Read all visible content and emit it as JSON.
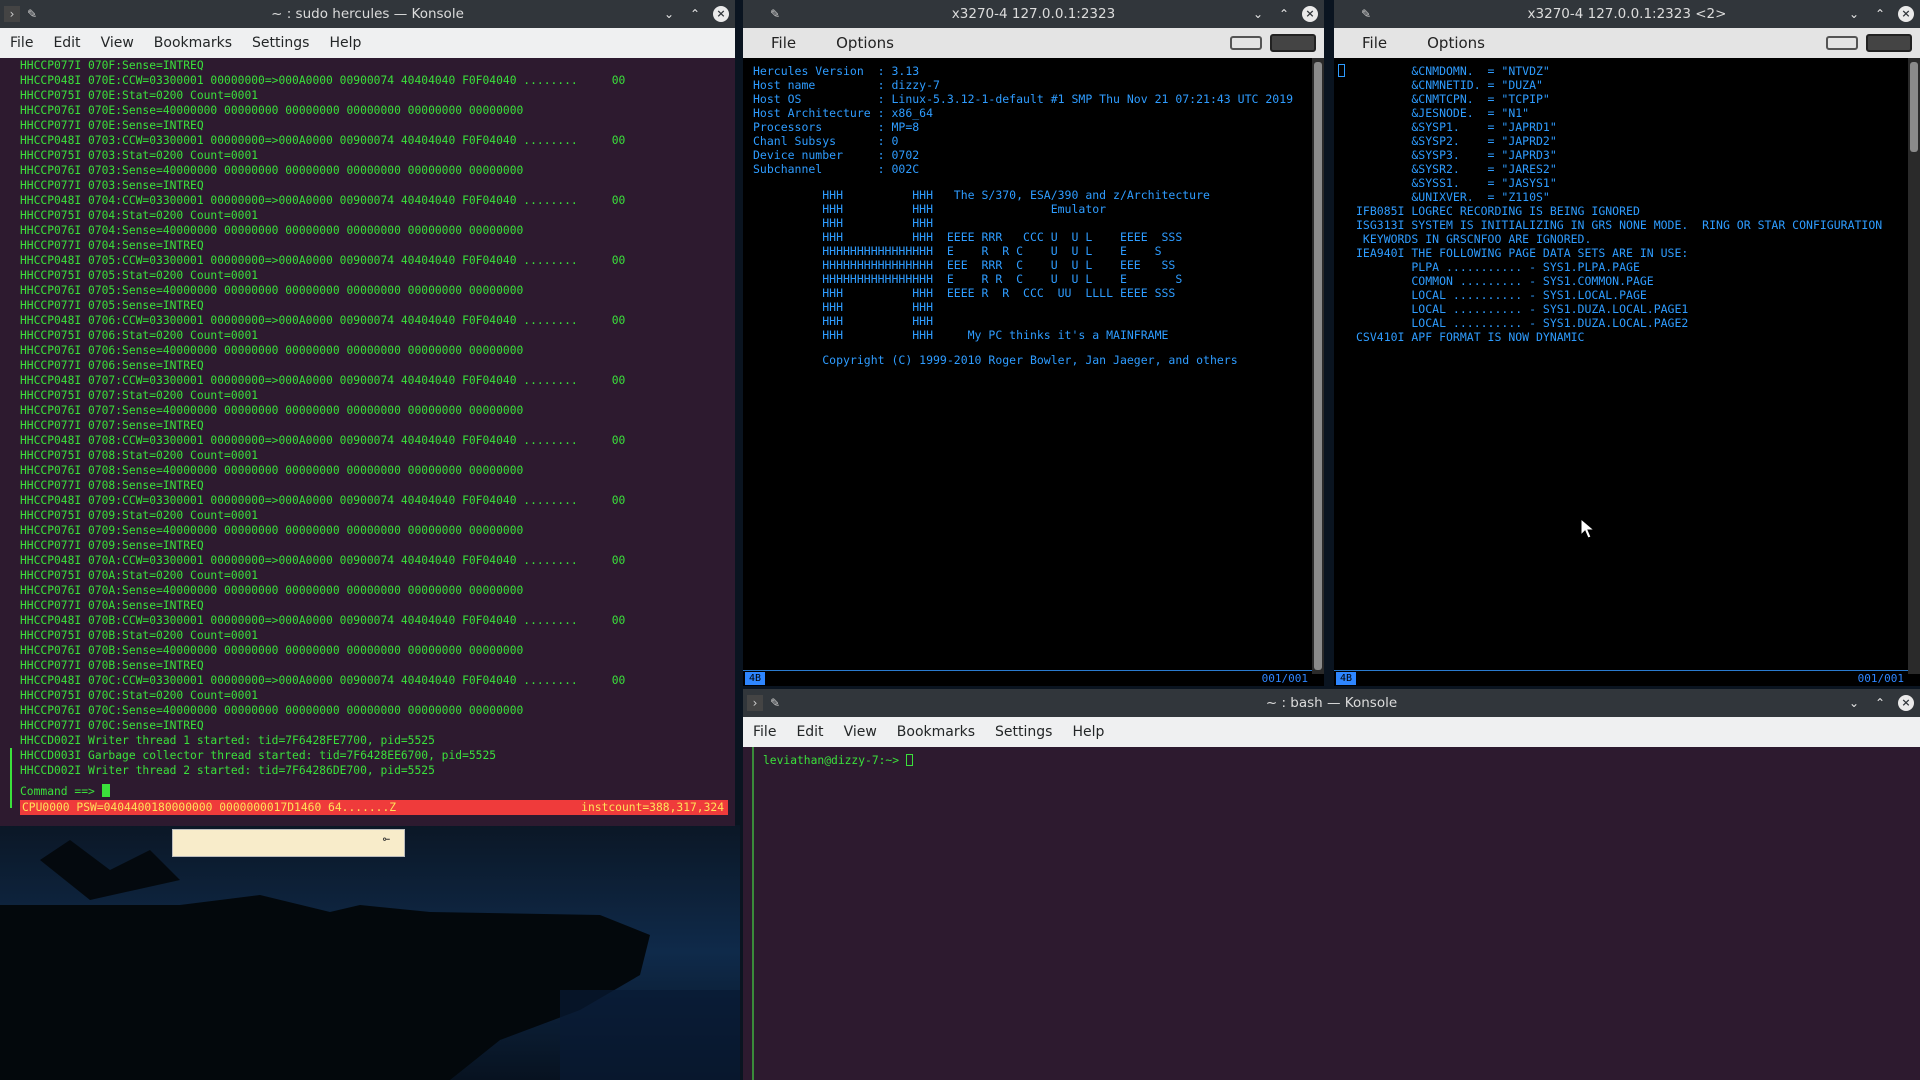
{
  "konsole_hercules": {
    "title": "~ : sudo hercules — Konsole",
    "menu": [
      "File",
      "Edit",
      "View",
      "Bookmarks",
      "Settings",
      "Help"
    ],
    "log_lines": [
      "HHCCP077I 070F:Sense=INTREQ",
      "HHCCP048I 070E:CCW=03300001 00000000=>000A0000 00900074 40404040 F0F04040 ........     00",
      "HHCCP075I 070E:Stat=0200 Count=0001",
      "HHCCP076I 070E:Sense=40000000 00000000 00000000 00000000 00000000 00000000",
      "HHCCP077I 070E:Sense=INTREQ",
      "HHCCP048I 0703:CCW=03300001 00000000=>000A0000 00900074 40404040 F0F04040 ........     00",
      "HHCCP075I 0703:Stat=0200 Count=0001",
      "HHCCP076I 0703:Sense=40000000 00000000 00000000 00000000 00000000 00000000",
      "HHCCP077I 0703:Sense=INTREQ",
      "HHCCP048I 0704:CCW=03300001 00000000=>000A0000 00900074 40404040 F0F04040 ........     00",
      "HHCCP075I 0704:Stat=0200 Count=0001",
      "HHCCP076I 0704:Sense=40000000 00000000 00000000 00000000 00000000 00000000",
      "HHCCP077I 0704:Sense=INTREQ",
      "HHCCP048I 0705:CCW=03300001 00000000=>000A0000 00900074 40404040 F0F04040 ........     00",
      "HHCCP075I 0705:Stat=0200 Count=0001",
      "HHCCP076I 0705:Sense=40000000 00000000 00000000 00000000 00000000 00000000",
      "HHCCP077I 0705:Sense=INTREQ",
      "HHCCP048I 0706:CCW=03300001 00000000=>000A0000 00900074 40404040 F0F04040 ........     00",
      "HHCCP075I 0706:Stat=0200 Count=0001",
      "HHCCP076I 0706:Sense=40000000 00000000 00000000 00000000 00000000 00000000",
      "HHCCP077I 0706:Sense=INTREQ",
      "HHCCP048I 0707:CCW=03300001 00000000=>000A0000 00900074 40404040 F0F04040 ........     00",
      "HHCCP075I 0707:Stat=0200 Count=0001",
      "HHCCP076I 0707:Sense=40000000 00000000 00000000 00000000 00000000 00000000",
      "HHCCP077I 0707:Sense=INTREQ",
      "HHCCP048I 0708:CCW=03300001 00000000=>000A0000 00900074 40404040 F0F04040 ........     00",
      "HHCCP075I 0708:Stat=0200 Count=0001",
      "HHCCP076I 0708:Sense=40000000 00000000 00000000 00000000 00000000 00000000",
      "HHCCP077I 0708:Sense=INTREQ",
      "HHCCP048I 0709:CCW=03300001 00000000=>000A0000 00900074 40404040 F0F04040 ........     00",
      "HHCCP075I 0709:Stat=0200 Count=0001",
      "HHCCP076I 0709:Sense=40000000 00000000 00000000 00000000 00000000 00000000",
      "HHCCP077I 0709:Sense=INTREQ",
      "HHCCP048I 070A:CCW=03300001 00000000=>000A0000 00900074 40404040 F0F04040 ........     00",
      "HHCCP075I 070A:Stat=0200 Count=0001",
      "HHCCP076I 070A:Sense=40000000 00000000 00000000 00000000 00000000 00000000",
      "HHCCP077I 070A:Sense=INTREQ",
      "HHCCP048I 070B:CCW=03300001 00000000=>000A0000 00900074 40404040 F0F04040 ........     00",
      "HHCCP075I 070B:Stat=0200 Count=0001",
      "HHCCP076I 070B:Sense=40000000 00000000 00000000 00000000 00000000 00000000",
      "HHCCP077I 070B:Sense=INTREQ",
      "HHCCP048I 070C:CCW=03300001 00000000=>000A0000 00900074 40404040 F0F04040 ........     00",
      "HHCCP075I 070C:Stat=0200 Count=0001",
      "HHCCP076I 070C:Sense=40000000 00000000 00000000 00000000 00000000 00000000",
      "HHCCP077I 070C:Sense=INTREQ",
      "HHCCD002I Writer thread 1 started: tid=7F6428FE7700, pid=5525",
      "HHCCD003I Garbage collector thread started: tid=7F6428EE6700, pid=5525",
      "HHCCD002I Writer thread 2 started: tid=7F64286DE700, pid=5525"
    ],
    "command_prompt": "Command ==> ",
    "status_left": "CPU0000 PSW=0404400180000000 0000000017D1460 64.......Z",
    "status_right": "instcount=388,317,324"
  },
  "x3270_1": {
    "title": "x3270-4 127.0.0.1:2323",
    "menu": [
      "File",
      "Options"
    ],
    "lines": [
      "Hercules Version  : 3.13",
      "Host name         : dizzy-7",
      "Host OS           : Linux-5.3.12-1-default #1 SMP Thu Nov 21 07:21:43 UTC 2019",
      "Host Architecture : x86_64",
      "Processors        : MP=8",
      "Chanl Subsys      : 0",
      "Device number     : 0702",
      "Subchannel        : 002C",
      "",
      "          HHH          HHH   The S/370, ESA/390 and z/Architecture",
      "          HHH          HHH                 Emulator",
      "          HHH          HHH",
      "          HHH          HHH  EEEE RRR   CCC U  U L    EEEE  SSS",
      "          HHHHHHHHHHHHHHHH  E    R  R C    U  U L    E    S",
      "          HHHHHHHHHHHHHHHH  EEE  RRR  C    U  U L    EEE   SS",
      "          HHHHHHHHHHHHHHHH  E    R R  C    U  U L    E       S",
      "          HHH          HHH  EEEE R  R  CCC  UU  LLLL EEEE SSS",
      "          HHH          HHH",
      "          HHH          HHH",
      "          HHH          HHH     My PC thinks it's a MAINFRAME",
      "",
      "          Copyright (C) 1999-2010 Roger Bowler, Jan Jaeger, and others"
    ],
    "oia_left": "4B",
    "oia_right": "001/001"
  },
  "x3270_2": {
    "title": "x3270-4 127.0.0.1:2323 <2>",
    "menu": [
      "File",
      "Options"
    ],
    "lines": [
      "        &CNMDOMN.  = \"NTVDZ\"",
      "        &CNMNETID. = \"DUZA\"",
      "        &CNMTCPN.  = \"TCPIP\"",
      "        &JESNODE.  = \"N1\"",
      "        &SYSP1.    = \"JAPRD1\"",
      "        &SYSP2.    = \"JAPRD2\"",
      "        &SYSP3.    = \"JAPRD3\"",
      "        &SYSR2.    = \"JARES2\"",
      "        &SYSS1.    = \"JASYS1\"",
      "        &UNIXVER.  = \"Z110S\"",
      "IFB085I LOGREC RECORDING IS BEING IGNORED",
      "ISG313I SYSTEM IS INITIALIZING IN GRS NONE MODE.  RING OR STAR CONFIGURATION",
      " KEYWORDS IN GRSCNFOO ARE IGNORED.",
      "IEA940I THE FOLLOWING PAGE DATA SETS ARE IN USE:",
      "        PLPA ........... - SYS1.PLPA.PAGE",
      "        COMMON ......... - SYS1.COMMON.PAGE",
      "        LOCAL .......... - SYS1.LOCAL.PAGE",
      "        LOCAL .......... - SYS1.DUZA.LOCAL.PAGE1",
      "        LOCAL .......... - SYS1.DUZA.LOCAL.PAGE2",
      "CSV410I APF FORMAT IS NOW DYNAMIC"
    ],
    "oia_left": "4B",
    "oia_right": "001/001"
  },
  "konsole_bash": {
    "title": "~ : bash — Konsole",
    "menu": [
      "File",
      "Edit",
      "View",
      "Bookmarks",
      "Settings",
      "Help"
    ],
    "prompt": "leviathan@dizzy-7:~> "
  },
  "colors": {
    "terminal_green": "#3be03b",
    "x3270_blue": "#2e9cff",
    "konsole_bg": "#2d1a2f",
    "status_red": "#ef3b3b"
  }
}
